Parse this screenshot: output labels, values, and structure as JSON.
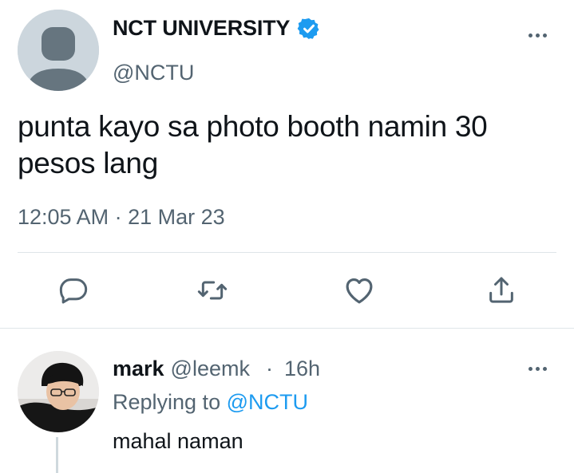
{
  "tweet": {
    "display_name": "NCT UNIVERSITY",
    "handle": "@NCTU",
    "text": "punta kayo sa photo booth namin 30 pesos lang",
    "timestamp": "12:05 AM · 21 Mar 23",
    "verified_icon": "verified-badge-icon",
    "actions": [
      {
        "name": "reply",
        "icon": "reply-icon"
      },
      {
        "name": "retweet",
        "icon": "retweet-icon"
      },
      {
        "name": "like",
        "icon": "heart-icon"
      },
      {
        "name": "share",
        "icon": "share-icon"
      }
    ]
  },
  "reply": {
    "name": "mark",
    "handle": "@leemk",
    "separator": "·",
    "time": "16h",
    "replying_prefix": "Replying to",
    "replying_handle": "@NCTU",
    "text": "mahal naman"
  },
  "colors": {
    "text": "#0f1419",
    "secondary": "#536471",
    "accent": "#1d9bf0",
    "divider": "#dfe5e9"
  }
}
